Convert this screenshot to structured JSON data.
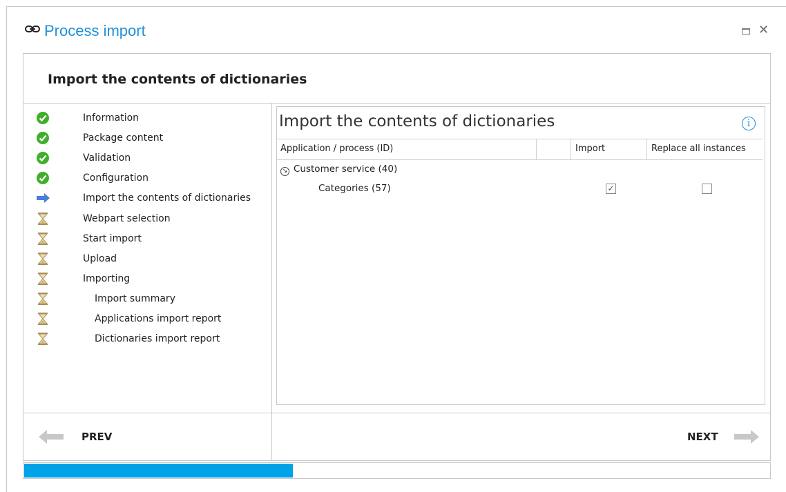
{
  "window": {
    "title": "Process import",
    "app_icon": "link-icon",
    "maximize_icon": "maximize-icon",
    "close_glyph": "✕"
  },
  "header": {
    "title": "Import the contents of dictionaries"
  },
  "steps": [
    {
      "label": "Information",
      "status": "done",
      "indent": false
    },
    {
      "label": "Package content",
      "status": "done",
      "indent": false
    },
    {
      "label": "Validation",
      "status": "done",
      "indent": false
    },
    {
      "label": "Configuration",
      "status": "done",
      "indent": false
    },
    {
      "label": "Import the contents of dictionaries",
      "status": "current",
      "indent": false
    },
    {
      "label": "Webpart selection",
      "status": "pending",
      "indent": false
    },
    {
      "label": "Start import",
      "status": "pending",
      "indent": false
    },
    {
      "label": "Upload",
      "status": "pending",
      "indent": false
    },
    {
      "label": "Importing",
      "status": "pending",
      "indent": false
    },
    {
      "label": "Import summary",
      "status": "pending",
      "indent": true
    },
    {
      "label": "Applications import report",
      "status": "pending",
      "indent": true
    },
    {
      "label": "Dictionaries import report",
      "status": "pending",
      "indent": true
    }
  ],
  "content": {
    "title": "Import the contents of dictionaries",
    "info_glyph": "i",
    "columns": [
      "Application / process (ID)",
      "",
      "Import",
      "Replace all instances"
    ],
    "group": {
      "label": "Customer service (40)",
      "expand_glyph": "↘"
    },
    "rows": [
      {
        "label": "Categories (57)",
        "import": true,
        "replace_all": false
      }
    ]
  },
  "nav": {
    "prev_label": "PREV",
    "next_label": "NEXT"
  },
  "progress": {
    "value": 0.36
  },
  "colors": {
    "title": "#1e90d8",
    "progress": "#00a2e8",
    "done": "#3fae2a",
    "current_arrow": "#4a7fd4",
    "pending_hourglass": "#d8c27a"
  }
}
